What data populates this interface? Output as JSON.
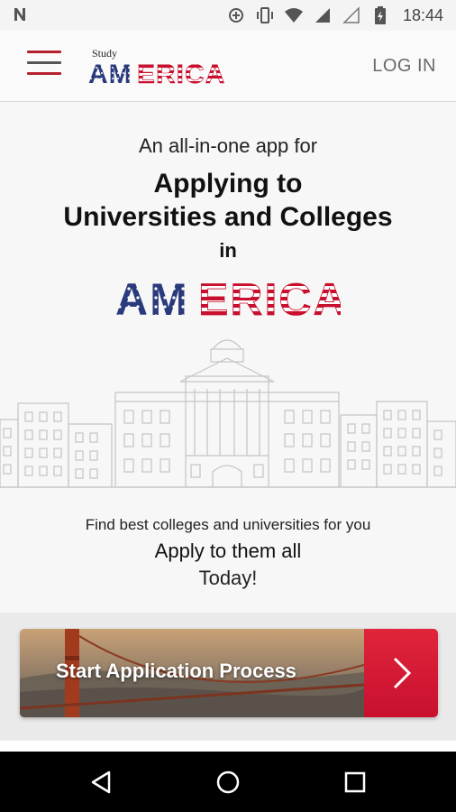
{
  "status_bar": {
    "carrier_icon": "n-notification-icon",
    "icons": [
      "sync-icon",
      "vibrate-icon",
      "wifi-icon",
      "signal-icon",
      "signal-empty-icon",
      "battery-charging-icon"
    ],
    "time": "18:44"
  },
  "app_bar": {
    "menu_icon": "hamburger-menu-icon",
    "brand_small": "Study",
    "brand_logo": "AMERICA",
    "login_label": "LOG IN"
  },
  "hero": {
    "tagline": "An all-in-one app for",
    "headline_line1": "Applying to",
    "headline_line2": "Universities and Colleges",
    "in_word": "in",
    "logo_text": "AMERICA",
    "illustration": "campus-building-illustration"
  },
  "promo": {
    "find_text": "Find best colleges and universities for you",
    "apply_text": "Apply to them all",
    "today_text": "Today!"
  },
  "cta": {
    "label": "Start Application Process",
    "arrow_icon": "chevron-right-icon",
    "background": "golden-gate-bridge-photo"
  },
  "nav_bar": {
    "back_icon": "back-triangle-icon",
    "home_icon": "home-circle-icon",
    "recents_icon": "recents-square-icon"
  },
  "colors": {
    "flag_red": "#c8102e",
    "flag_blue": "#2a3a7c",
    "accent_red": "#d81b34"
  }
}
